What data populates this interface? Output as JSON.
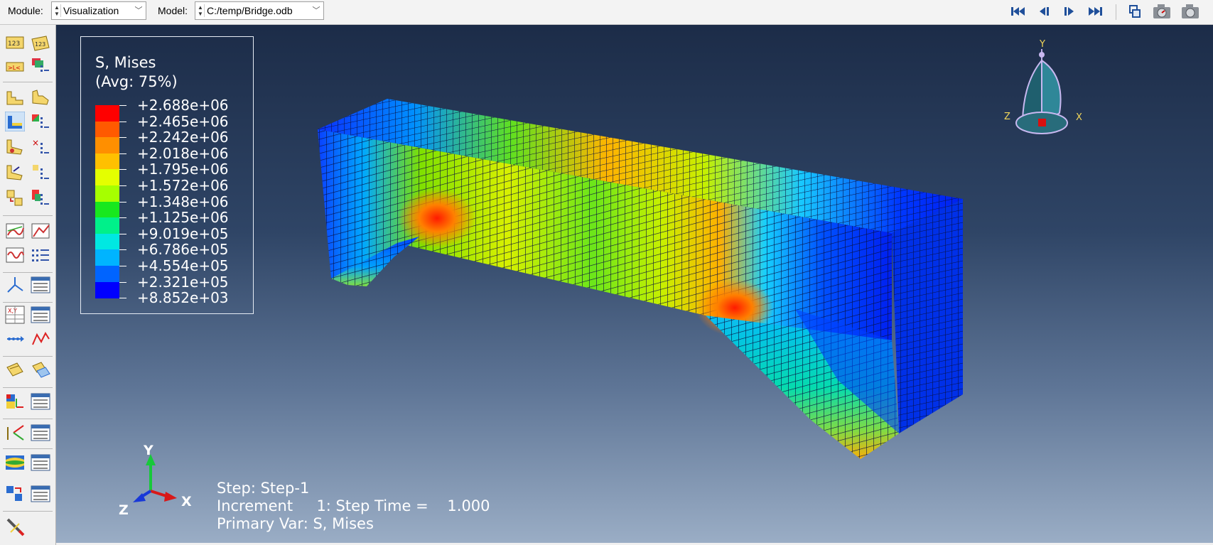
{
  "toolbar": {
    "module_label": "Module:",
    "module_value": "Visualization",
    "model_label": "Model:",
    "model_value": "C:/temp/Bridge.odb"
  },
  "legend": {
    "title": "S, Mises",
    "subtitle": "(Avg: 75%)",
    "values": [
      "+2.688e+06",
      "+2.465e+06",
      "+2.242e+06",
      "+2.018e+06",
      "+1.795e+06",
      "+1.572e+06",
      "+1.348e+06",
      "+1.125e+06",
      "+9.019e+05",
      "+6.786e+05",
      "+4.554e+05",
      "+2.321e+05",
      "+8.852e+03"
    ],
    "colors": [
      "#ff0000",
      "#ff5a00",
      "#ff8f00",
      "#ffc000",
      "#e4ff00",
      "#a6ff00",
      "#66f000",
      "#18e81e",
      "#00f08a",
      "#00e8e2",
      "#00b4ff",
      "#0064ff",
      "#0000ff"
    ]
  },
  "info": {
    "step": "Step: Step-1",
    "increment": "Increment     1: Step Time =    1.000",
    "primary_var": "Primary Var: S, Mises"
  },
  "triad": {
    "y": "Y",
    "z": "Z",
    "x": "X"
  },
  "view_cube_labels": {
    "y": "Y",
    "z": "Z",
    "x": "X"
  }
}
